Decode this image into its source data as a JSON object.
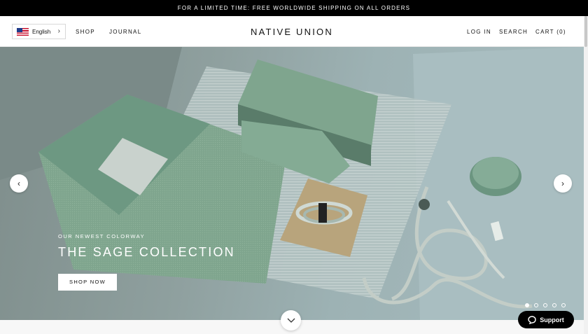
{
  "promo_bar": {
    "text": "FOR A LIMITED TIME: FREE WORLDWIDE SHIPPING ON ALL ORDERS"
  },
  "header": {
    "language": {
      "label": "English",
      "flag_icon": "us-flag-icon"
    },
    "nav_left": [
      "SHOP",
      "JOURNAL"
    ],
    "logo": "NATIVE UNION",
    "nav_right": {
      "login": "LOG IN",
      "search": "SEARCH",
      "cart": "CART (0)"
    }
  },
  "hero": {
    "eyebrow": "OUR NEWEST COLORWAY",
    "headline": "THE SAGE COLLECTION",
    "cta": "SHOP NOW",
    "slide_count": 5,
    "active_slide": 1,
    "prev_icon": "chevron-left-icon",
    "next_icon": "chevron-right-icon",
    "scroll_icon": "chevron-down-icon"
  },
  "support_button": {
    "label": "Support",
    "icon": "chat-bubble-icon"
  },
  "colors": {
    "accent_sage": "#7fa58e",
    "hero_bg": "#9db0b1",
    "black": "#000000"
  }
}
